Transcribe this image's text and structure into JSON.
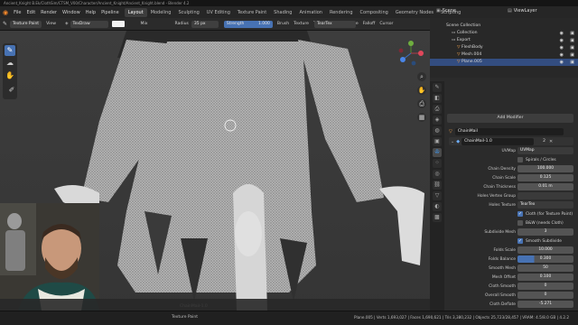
{
  "window": {
    "title": "Ancient_Knight B.Ek/ClothSim/CTSM_V00/Character/Ancient_Knight/Ancient_Knight.blend - Blender 4.2"
  },
  "menubar": {
    "items": [
      "File",
      "Edit",
      "Render",
      "Window",
      "Help",
      "Pipeline"
    ],
    "workspaces": [
      "Layout",
      "Modeling",
      "Sculpting",
      "UV Editing",
      "Texture Paint",
      "Shading",
      "Animation",
      "Rendering",
      "Compositing",
      "Geometry Nodes",
      "Scripting"
    ],
    "active_workspace": "Layout",
    "scene": "Scene",
    "view_layer": "ViewLayer"
  },
  "tool_header": {
    "mode": "Texture Paint",
    "view": "View",
    "brush": "TexDraw",
    "blend": "Mix",
    "radius_label": "Radius",
    "radius_value": "35 px",
    "strength_label": "Strength",
    "strength_value": "1.000",
    "menus": [
      "Brush",
      "Texture",
      "Texture Mask",
      "Stroke",
      "Falloff",
      "Cursor"
    ],
    "image": "TearTex"
  },
  "viewport": {
    "texture_slot": "ChainMail-1.0",
    "texture_slot_bottom": "ChainMail-1.0"
  },
  "status_bar": {
    "left": "Texture Paint",
    "stats": "Plane.005 | Verts 1,693,027 | Faces 1,690,621 | Tris 3,380,232 | Objects 25,723/28,457 | VRAM: 4.5/8.0 GB | 4.2.2"
  },
  "outliner": {
    "header": "Scene Collection",
    "items": [
      {
        "label": "Collection",
        "indent": 1
      },
      {
        "label": "Export",
        "indent": 1
      },
      {
        "label": "FleshBody",
        "indent": 2
      },
      {
        "label": "Mesh.004",
        "indent": 2
      },
      {
        "label": "Plane.005",
        "indent": 2,
        "selected": true
      }
    ]
  },
  "properties": {
    "add_modifier": "Add Modifier",
    "object_name": "ChainMail",
    "modifier_name": "ChainMail-1.0",
    "modifier_count": "2",
    "rows": [
      {
        "label": "UVMap",
        "value": "UVMap",
        "kind": "dark"
      },
      {
        "label": "",
        "value": "Spirals / Circles",
        "kind": "check",
        "on": false
      },
      {
        "label": "Chain Density",
        "value": "100.000",
        "kind": "field"
      },
      {
        "label": "Chain Scale",
        "value": "0.125",
        "kind": "field"
      },
      {
        "label": "Chain Thickness",
        "value": "0.01 m",
        "kind": "field"
      },
      {
        "label": "Holes Vertex Group",
        "value": "",
        "kind": "dark"
      },
      {
        "label": "Holes Texture",
        "value": "TearTex",
        "kind": "dark"
      },
      {
        "label": "",
        "value": "Cloth (for Texture Paint)",
        "kind": "check",
        "on": true
      },
      {
        "label": "",
        "value": "B&W (needs Cloth)",
        "kind": "check",
        "on": false
      },
      {
        "label": "Subdivide Mesh",
        "value": "3",
        "kind": "field"
      },
      {
        "label": "",
        "value": "Smooth Subdivide",
        "kind": "check",
        "on": true
      },
      {
        "label": "Folds Scale",
        "value": "10.000",
        "kind": "field"
      },
      {
        "label": "Folds Balance",
        "value": "0.300",
        "kind": "blue"
      },
      {
        "label": "Smooth Mesh",
        "value": "50",
        "kind": "field"
      },
      {
        "label": "Mesh Offset",
        "value": "0.100",
        "kind": "field"
      },
      {
        "label": "Cloth Smooth",
        "value": "0",
        "kind": "field"
      },
      {
        "label": "Overall Smooth",
        "value": "0",
        "kind": "field"
      },
      {
        "label": "Cloth Deflate",
        "value": "-5.271",
        "kind": "field"
      }
    ]
  }
}
